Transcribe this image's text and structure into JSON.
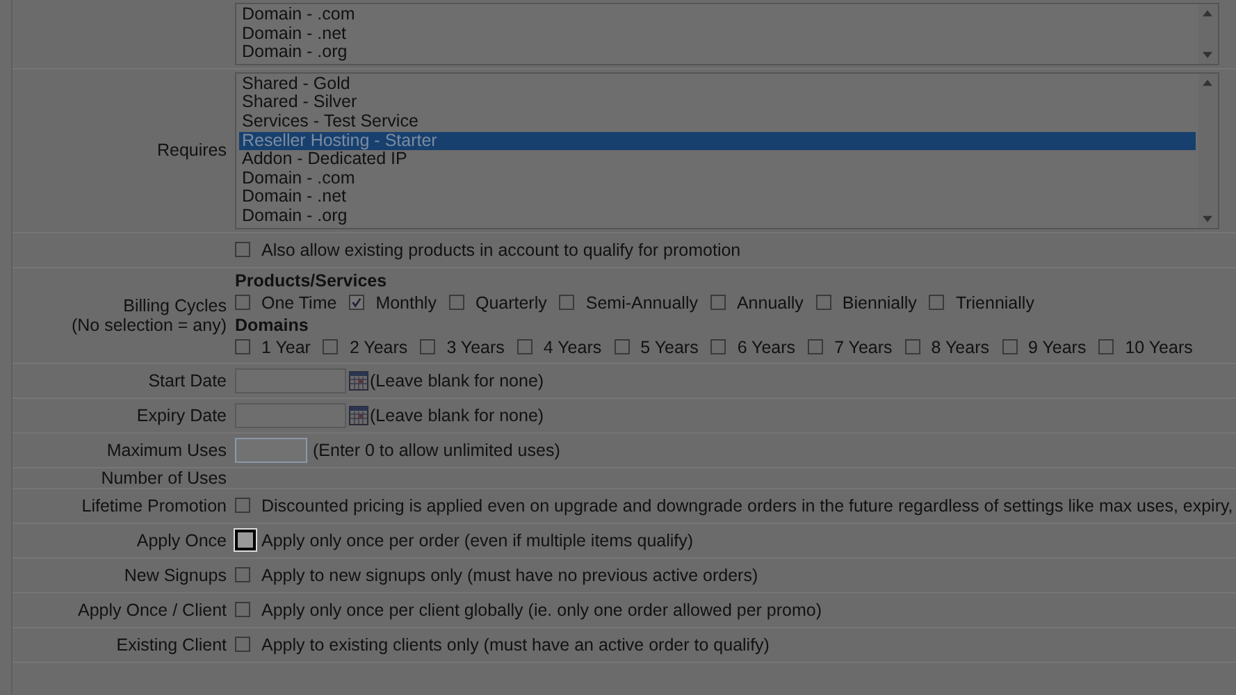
{
  "rows": [
    {
      "kind": "listbox",
      "items": [
        {
          "text": "Domain - .com",
          "selected": false
        },
        {
          "text": "Domain - .net",
          "selected": false
        },
        {
          "text": "Domain - .org",
          "selected": false
        }
      ]
    },
    {
      "kind": "listbox",
      "label": "Requires",
      "items": [
        {
          "text": "Shared - Gold",
          "selected": false
        },
        {
          "text": "Shared - Silver",
          "selected": false
        },
        {
          "text": "Services - Test Service",
          "selected": false
        },
        {
          "text": "Reseller Hosting - Starter",
          "selected": true
        },
        {
          "text": "Addon - Dedicated IP",
          "selected": false
        },
        {
          "text": "Domain - .com",
          "selected": false
        },
        {
          "text": "Domain - .net",
          "selected": false
        },
        {
          "text": "Domain - .org",
          "selected": false
        }
      ]
    },
    {
      "kind": "checkbox",
      "checked": false,
      "focused": false,
      "text": "Also allow existing products in account to qualify for promotion"
    },
    {
      "kind": "cycles",
      "label": "Billing Cycles",
      "sublabel": "(No selection = any)",
      "groups": [
        {
          "title": "Products/Services",
          "options": [
            {
              "text": "One Time",
              "checked": false
            },
            {
              "text": "Monthly",
              "checked": true
            },
            {
              "text": "Quarterly",
              "checked": false
            },
            {
              "text": "Semi-Annually",
              "checked": false
            },
            {
              "text": "Annually",
              "checked": false
            },
            {
              "text": "Biennially",
              "checked": false
            },
            {
              "text": "Triennially",
              "checked": false
            }
          ]
        },
        {
          "title": "Domains",
          "options": [
            {
              "text": "1 Year",
              "checked": false
            },
            {
              "text": "2 Years",
              "checked": false
            },
            {
              "text": "3 Years",
              "checked": false
            },
            {
              "text": "4 Years",
              "checked": false
            },
            {
              "text": "5 Years",
              "checked": false
            },
            {
              "text": "6 Years",
              "checked": false
            },
            {
              "text": "7 Years",
              "checked": false
            },
            {
              "text": "8 Years",
              "checked": false
            },
            {
              "text": "9 Years",
              "checked": false
            },
            {
              "text": "10 Years",
              "checked": false
            }
          ]
        }
      ]
    },
    {
      "kind": "date",
      "label": "Start Date",
      "note": "(Leave blank for none)"
    },
    {
      "kind": "date",
      "label": "Expiry Date",
      "note": "(Leave blank for none)"
    },
    {
      "kind": "input",
      "label": "Maximum Uses",
      "focused": true,
      "note": "(Enter 0 to allow unlimited uses)"
    },
    {
      "kind": "empty",
      "label": "Number of Uses"
    },
    {
      "kind": "checkbox",
      "label": "Lifetime Promotion",
      "checked": false,
      "focused": false,
      "text": "Discounted pricing is applied even on upgrade and downgrade orders in the future regardless of settings like max uses, expiry,"
    },
    {
      "kind": "checkbox",
      "label": "Apply Once",
      "checked": false,
      "focused": true,
      "text": "Apply only once per order (even if multiple items qualify)"
    },
    {
      "kind": "checkbox",
      "label": "New Signups",
      "checked": false,
      "focused": false,
      "text": "Apply to new signups only (must have no previous active orders)"
    },
    {
      "kind": "checkbox",
      "label": "Apply Once / Client",
      "checked": false,
      "focused": false,
      "text": "Apply only once per client globally (ie. only one order allowed per promo)"
    },
    {
      "kind": "checkbox",
      "label": "Existing Client",
      "checked": false,
      "focused": false,
      "text": "Apply to existing clients only (must have an active order to qualify)"
    }
  ]
}
